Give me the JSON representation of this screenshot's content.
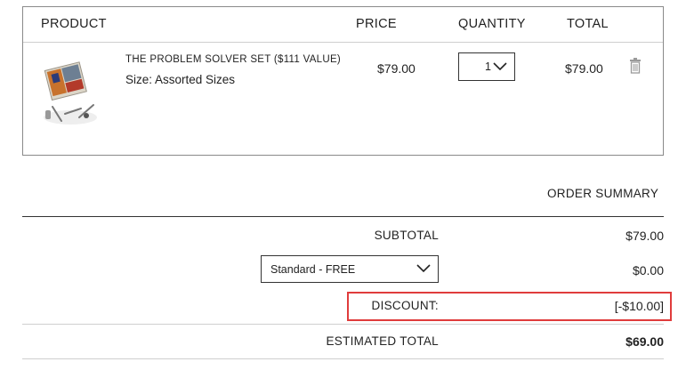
{
  "cart": {
    "headers": {
      "product": "PRODUCT",
      "price": "PRICE",
      "quantity": "QUANTITY",
      "total": "TOTAL"
    },
    "items": [
      {
        "name": "THE PROBLEM SOLVER SET ($111 VALUE)",
        "size": "Size: Assorted Sizes",
        "price": "$79.00",
        "quantity": "1",
        "total": "$79.00",
        "remove_icon": "trash-icon"
      }
    ]
  },
  "summary": {
    "title": "ORDER SUMMARY",
    "subtotal_label": "SUBTOTAL",
    "subtotal_value": "$79.00",
    "shipping_option": "Standard - FREE",
    "shipping_value": "$0.00",
    "discount_label": "DISCOUNT:",
    "discount_value": "[-$10.00]",
    "estimated_total_label": "ESTIMATED TOTAL",
    "estimated_total_value": "$69.00"
  },
  "colors": {
    "highlight_border": "#e03c3c",
    "border": "#8a8a8a",
    "text": "#222222"
  }
}
